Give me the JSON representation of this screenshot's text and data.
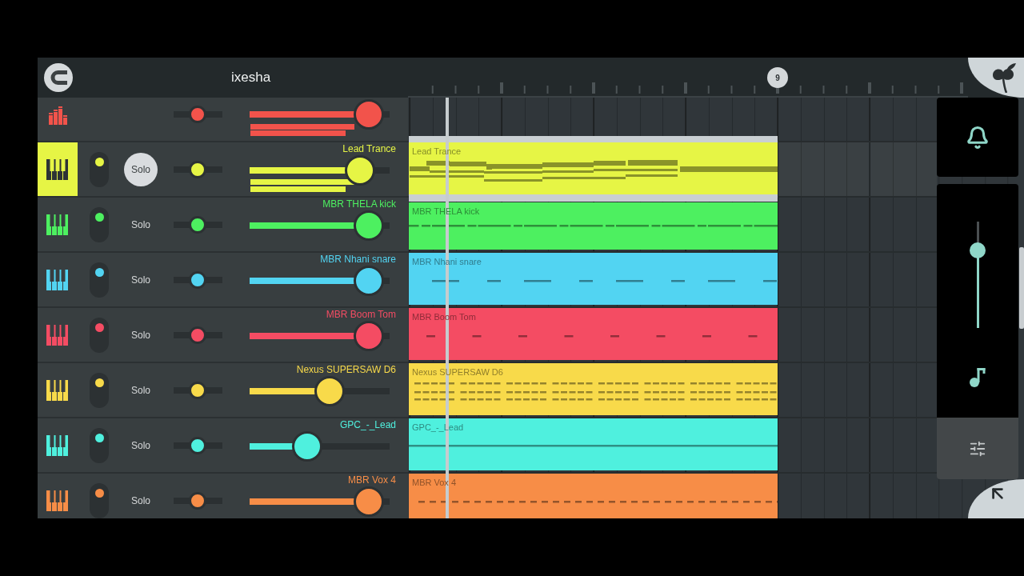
{
  "header": {
    "title": "ixesha"
  },
  "timeline": {
    "marker": "9"
  },
  "channels": [
    {
      "kind": "master",
      "color": "#f2534b",
      "selected": false,
      "pan": {
        "level": 0.5
      },
      "volume": {
        "level": 0.85
      },
      "meters": [
        {
          "level": 0.74
        },
        {
          "level": 0.68
        }
      ]
    },
    {
      "kind": "instrument",
      "name": "Lead Trance",
      "color": "#e6f545",
      "selected": true,
      "enabled": true,
      "solo": {
        "label": "Solo",
        "on": true
      },
      "pan": {
        "level": 0.5
      },
      "volume": {
        "level": 0.79
      },
      "meters": [
        {
          "level": 0.74
        },
        {
          "level": 0.68
        }
      ],
      "clip": {
        "name": "Lead Trance",
        "kind": "melody",
        "selected": true
      }
    },
    {
      "kind": "instrument",
      "name": "MBR THELA kick",
      "color": "#4df060",
      "selected": false,
      "enabled": true,
      "solo": {
        "label": "Solo",
        "on": false
      },
      "pan": {
        "level": 0.5
      },
      "volume": {
        "level": 0.85
      },
      "clip": {
        "name": "MBR THELA kick",
        "kind": "beat",
        "selected": false
      }
    },
    {
      "kind": "instrument",
      "name": "MBR Nhani snare",
      "color": "#52d4f2",
      "selected": false,
      "enabled": true,
      "solo": {
        "label": "Solo",
        "on": false
      },
      "pan": {
        "level": 0.5
      },
      "volume": {
        "level": 0.85
      },
      "clip": {
        "name": "MBR Nhani snare",
        "kind": "offbeat",
        "selected": false
      }
    },
    {
      "kind": "instrument",
      "name": "MBR Boom Tom",
      "color": "#f44c63",
      "selected": false,
      "enabled": true,
      "solo": {
        "label": "Solo",
        "on": false
      },
      "pan": {
        "level": 0.5
      },
      "volume": {
        "level": 0.85
      },
      "clip": {
        "name": "MBR Boom Tom",
        "kind": "ticks",
        "selected": false
      }
    },
    {
      "kind": "instrument",
      "name": "Nexus SUPERSAW D6",
      "color": "#f8da4a",
      "selected": false,
      "enabled": true,
      "solo": {
        "label": "Solo",
        "on": false
      },
      "pan": {
        "level": 0.5
      },
      "volume": {
        "level": 0.57
      },
      "clip": {
        "name": "Nexus SUPERSAW D6",
        "kind": "chords",
        "selected": false
      }
    },
    {
      "kind": "instrument",
      "name": "GPC_-_Lead",
      "color": "#4ff0de",
      "selected": false,
      "enabled": true,
      "solo": {
        "label": "Solo",
        "on": false
      },
      "pan": {
        "level": 0.5
      },
      "volume": {
        "level": 0.41
      },
      "clip": {
        "name": "GPC_-_Lead",
        "kind": "line",
        "selected": false
      }
    },
    {
      "kind": "instrument",
      "name": "MBR Vox 4",
      "color": "#f78d47",
      "selected": false,
      "enabled": true,
      "solo": {
        "label": "Solo",
        "on": false
      },
      "pan": {
        "level": 0.5
      },
      "volume": {
        "level": 0.85
      },
      "clip": {
        "name": "MBR Vox 4",
        "kind": "dashes",
        "selected": false
      }
    }
  ],
  "side_panel": {
    "slider": {
      "level": 0.73
    }
  }
}
